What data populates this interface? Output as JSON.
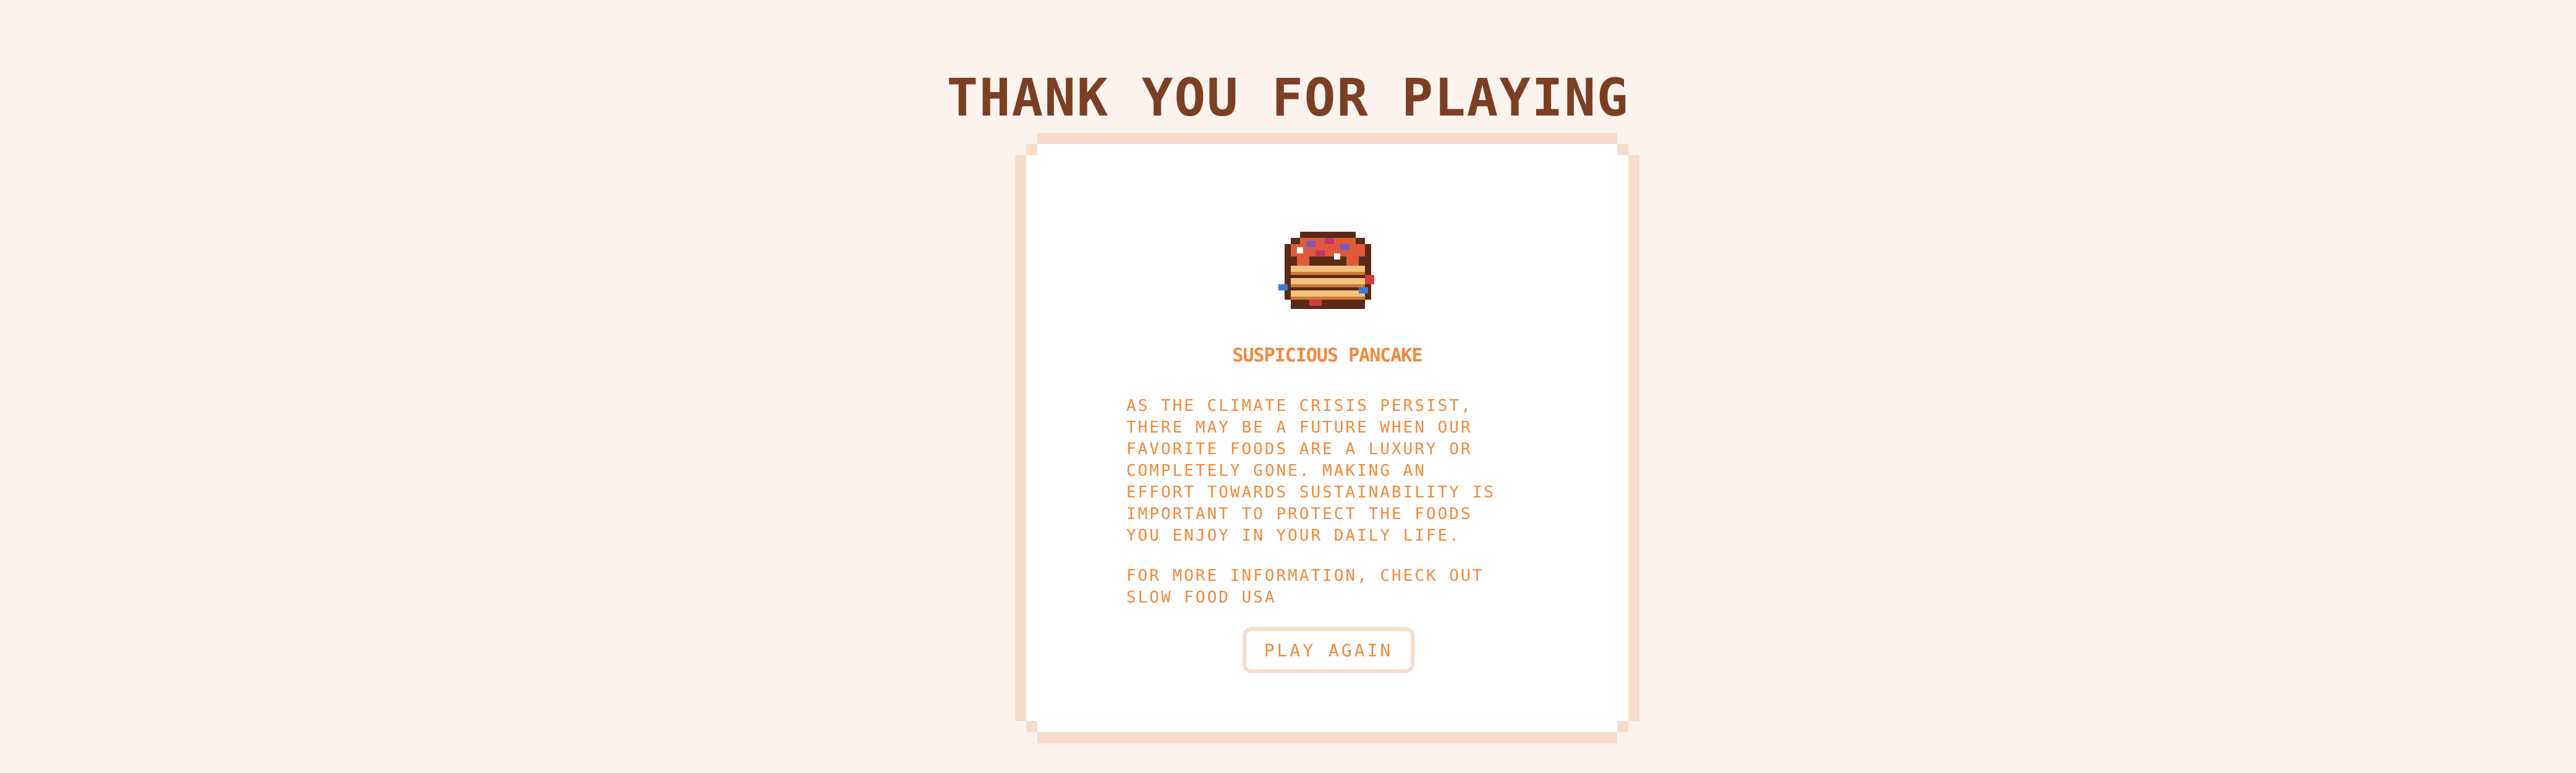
{
  "header": {
    "title": "THANK YOU FOR PLAYING"
  },
  "card": {
    "item_icon": "pancake-icon",
    "item_name": "SUSPICIOUS PANCAKE",
    "description": "AS THE CLIMATE CRISIS PERSIST,\nTHERE MAY BE A FUTURE WHEN OUR\nFAVORITE FOODS ARE A LUXURY OR\nCOMPLETELY GONE. MAKING AN\nEFFORT TOWARDS SUSTAINABILITY IS\nIMPORTANT TO PROTECT THE FOODS\nYOU ENJOY IN YOUR DAILY LIFE.",
    "more_info": "FOR MORE INFORMATION, CHECK OUT\nSLOW FOOD USA",
    "play_again_label": "PLAY AGAIN"
  },
  "colors": {
    "background": "#fcf3ee",
    "title": "#7a3f24",
    "accent": "#f2893a",
    "border": "#f6dccb"
  }
}
